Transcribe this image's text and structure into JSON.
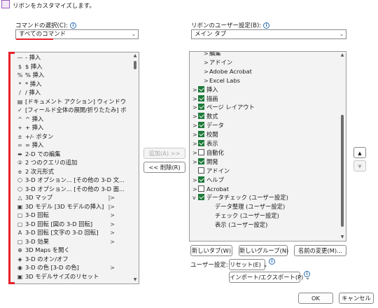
{
  "header": {
    "title": "リボンをカスタマイズします。"
  },
  "left": {
    "label": "コマンドの選択(C):",
    "combo_value": "すべてのコマンド",
    "items": [
      {
        "icon": "—",
        "icon_name": "dash-icon",
        "label": "- 挿入",
        "sub": ""
      },
      {
        "icon": "$",
        "icon_name": "dollar-icon",
        "label": "$ 挿入",
        "sub": ""
      },
      {
        "icon": "%",
        "icon_name": "percent-icon",
        "label": "% 挿入",
        "sub": ""
      },
      {
        "icon": "*",
        "icon_name": "asterisk-icon",
        "label": "* 挿入",
        "sub": ""
      },
      {
        "icon": "/",
        "icon_name": "slash-icon",
        "label": "/ 挿入",
        "sub": ""
      },
      {
        "icon": "▤",
        "icon_name": "document-action-icon",
        "label": "[ドキュメント アクション] ウィンドウ",
        "sub": ""
      },
      {
        "icon": "✓",
        "icon_name": "check-icon",
        "label": "[フィールド全体の展開/折りたたみ] ボ...",
        "sub": ""
      },
      {
        "icon": "^",
        "icon_name": "caret-icon",
        "label": "^ 挿入",
        "sub": ""
      },
      {
        "icon": "+",
        "icon_name": "plus-icon",
        "label": "+ 挿入",
        "sub": ""
      },
      {
        "icon": "±",
        "icon_name": "plus-minus-icon",
        "label": "+/- ボタン",
        "sub": ""
      },
      {
        "icon": "=",
        "icon_name": "equals-icon",
        "label": "= 挿入",
        "sub": ""
      },
      {
        "icon": "⬌",
        "icon_name": "two-d-edit-icon",
        "label": "2-D での編集",
        "sub": ""
      },
      {
        "icon": "②",
        "icon_name": "query-icon",
        "label": "2 つのクエリの追加",
        "sub": ""
      },
      {
        "icon": "e",
        "icon_name": "formula-icon",
        "label": "2 次元形式",
        "sub": ""
      },
      {
        "icon": "⬡",
        "icon_name": "three-d-option-icon",
        "label": "3-D オプション... [その他の 3-D 文...",
        "sub": ""
      },
      {
        "icon": "⬡",
        "icon_name": "three-d-option-icon",
        "label": "3-D オプション... [その他の 3-D 面...",
        "sub": ""
      },
      {
        "icon": "△",
        "icon_name": "three-d-map-icon",
        "label": "3D マップ",
        "sub": "|>"
      },
      {
        "icon": "▣",
        "icon_name": "three-d-model-icon",
        "label": "3D モデル [3D モデルの挿入]",
        "sub": "|>"
      },
      {
        "icon": "▢",
        "icon_name": "rotate-icon",
        "label": "3-D 回転",
        "sub": ">"
      },
      {
        "icon": "▢",
        "icon_name": "rotate-icon",
        "label": "3-D 回転 [図の 3-D 回転]",
        "sub": ">"
      },
      {
        "icon": "A",
        "icon_name": "text-rotate-icon",
        "label": "3-D 回転 [文字の 3-D 回転]",
        "sub": ">"
      },
      {
        "icon": "▢",
        "icon_name": "effect-icon",
        "label": "3-D 効果",
        "sub": ">"
      },
      {
        "icon": "⊕",
        "icon_name": "globe-icon",
        "label": "3D Maps を開く",
        "sub": ""
      },
      {
        "icon": "◈",
        "icon_name": "toggle-3d-icon",
        "label": "3-D のオン/オフ",
        "sub": ""
      },
      {
        "icon": "◉",
        "icon_name": "color-3d-icon",
        "label": "3-D の色 [3-D の色]",
        "sub": ">"
      },
      {
        "icon": "▣",
        "icon_name": "resize-3d-icon",
        "label": "3D モデルサイズのリセット",
        "sub": ""
      }
    ]
  },
  "middle": {
    "add_label": "追加(A) >>",
    "remove_label": "<< 削除(R)"
  },
  "right": {
    "label": "リボンのユーザー設定(B):",
    "combo_value": "メイン タブ",
    "items": [
      {
        "indent": 2,
        "chev": ">",
        "cb": "none",
        "label": "編集"
      },
      {
        "indent": 2,
        "chev": ">",
        "cb": "none",
        "label": "アドイン"
      },
      {
        "indent": 2,
        "chev": ">",
        "cb": "none",
        "label": "Adobe Acrobat"
      },
      {
        "indent": 2,
        "chev": ">",
        "cb": "none",
        "label": "Excel Labs"
      },
      {
        "indent": 0,
        "chev": ">",
        "cb": "on",
        "label": "挿入"
      },
      {
        "indent": 0,
        "chev": ">",
        "cb": "on",
        "label": "描画"
      },
      {
        "indent": 0,
        "chev": ">",
        "cb": "on",
        "label": "ページ レイアウト"
      },
      {
        "indent": 0,
        "chev": ">",
        "cb": "on",
        "label": "数式"
      },
      {
        "indent": 0,
        "chev": ">",
        "cb": "on",
        "label": "データ"
      },
      {
        "indent": 0,
        "chev": ">",
        "cb": "on",
        "label": "校閲"
      },
      {
        "indent": 0,
        "chev": ">",
        "cb": "on",
        "label": "表示"
      },
      {
        "indent": 0,
        "chev": ">",
        "cb": "off",
        "label": "自動化"
      },
      {
        "indent": 0,
        "chev": ">",
        "cb": "on",
        "label": "開発"
      },
      {
        "indent": 0,
        "chev": "",
        "cb": "off",
        "label": "アドイン"
      },
      {
        "indent": 0,
        "chev": ">",
        "cb": "on",
        "label": "ヘルプ"
      },
      {
        "indent": 0,
        "chev": ">",
        "cb": "off",
        "label": "Acrobat"
      },
      {
        "indent": 0,
        "chev": "v",
        "cb": "on",
        "label": "データチェック (ユーザー設定)"
      },
      {
        "indent": 3,
        "chev": "",
        "cb": "none",
        "label": "データ整理 (ユーザー設定)"
      },
      {
        "indent": 3,
        "chev": "",
        "cb": "none",
        "label": "チェック (ユーザー設定)"
      },
      {
        "indent": 3,
        "chev": "",
        "cb": "none",
        "label": "表示 (ユーザー設定)"
      }
    ],
    "new_tab": "新しいタブ(W)",
    "new_group": "新しいグループ(N)",
    "rename": "名前の変更(M)...",
    "user_settings_label": "ユーザー設定:",
    "reset": "リセット(E)",
    "import_export": "インポート/エクスポート(P)"
  },
  "footer": {
    "ok": "OK",
    "cancel": "キャンセル"
  },
  "colors": {
    "check": "#1d7a3a",
    "highlight": "#e8202a",
    "info": "#2b6cb0"
  }
}
